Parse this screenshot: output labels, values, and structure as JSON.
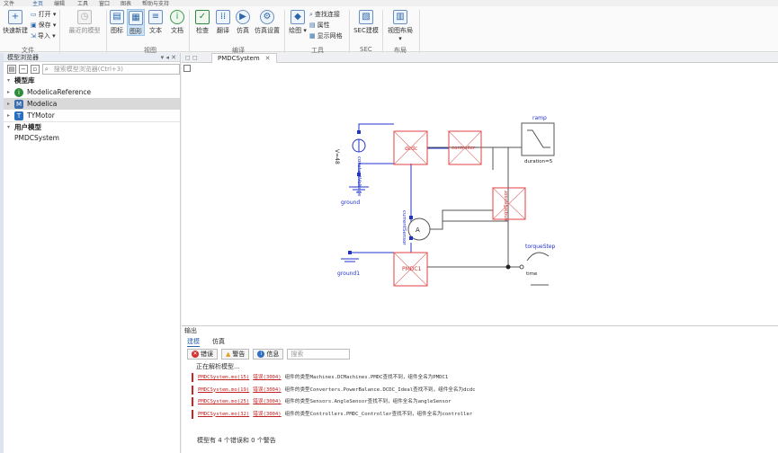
{
  "menubar": [
    "文件",
    "主页",
    "编辑",
    "工具",
    "窗口",
    "图表",
    "帮助与支持"
  ],
  "ribbon": {
    "file_group": {
      "new_label": "快速新建",
      "open_label": "打开",
      "save_label": "保存",
      "import_label": "导入",
      "group": "文件"
    },
    "recent_label": "最近的模型",
    "view_group": {
      "icon_label": "图标",
      "diagram_label": "图形",
      "text_label": "文本",
      "doc_label": "文档",
      "group": "视图"
    },
    "compile_group": {
      "check_label": "检查",
      "translate_label": "翻译",
      "simulate_label": "仿真",
      "sim_settings_label": "仿真设置",
      "group": "编译"
    },
    "tools_group": {
      "draw_label": "绘图",
      "find_conn_label": "查找连接",
      "attr_label": "属性",
      "grid_label": "显示网格",
      "group": "工具"
    },
    "sec_group": {
      "sec_model_label": "SEC建模",
      "group": "SEC"
    },
    "layout_group": {
      "view_layout_label": "视图布局",
      "group": "布局"
    }
  },
  "left_panel": {
    "title": "模型浏览器",
    "search_placeholder": "搜索模型浏览器(Ctrl+3)",
    "library_header": "模型库",
    "libraries": [
      {
        "label": "ModelicaReference",
        "color": "#2e8b3a",
        "glyph": "i"
      },
      {
        "label": "Modelica",
        "color": "#3c6fb0",
        "glyph": "M"
      },
      {
        "label": "TYMotor",
        "color": "#2b6fc0",
        "glyph": "T"
      }
    ],
    "user_header": "用户模型",
    "user_models": [
      "PMDCSystem"
    ]
  },
  "editor": {
    "tab_label": "PMDCSystem",
    "diagram": {
      "constantVoltage_label": "constantVoltage",
      "voltage_label": "V=48",
      "ground_label": "ground",
      "ground1_label": "ground1",
      "dcdc_label": "dcdc",
      "controller_label": "controller",
      "ramp_label": "ramp",
      "ramp_duration": "duration=5",
      "angleSensor_label": "angleSensor",
      "currentSensor_label": "currentSensor",
      "pmdc_label": "PMDC1",
      "torqueStep_label": "torqueStep",
      "time_label": "time"
    }
  },
  "output": {
    "title": "输出",
    "tabs": [
      "建模",
      "仿真"
    ],
    "filters": {
      "error_label": "错误",
      "warning_label": "警告",
      "info_label": "信息",
      "search_placeholder": "搜索"
    },
    "parsing_label": "正在解析模型...",
    "logs": [
      {
        "file": "PMDCSystem.mo(15)",
        "code": "错误(3004)",
        "msg": "组件的类型Machines.DCMachines.PMDC查找不到，组件全名为PMDC1"
      },
      {
        "file": "PMDCSystem.mo(19)",
        "code": "错误(3004)",
        "msg": "组件的类型Converters.PowerBalance.DCDC_Ideal查找不到，组件全名为dcdc"
      },
      {
        "file": "PMDCSystem.mo(25)",
        "code": "错误(3004)",
        "msg": "组件的类型Sensors.AngleSensor查找不到，组件全名为angleSensor"
      },
      {
        "file": "PMDCSystem.mo(32)",
        "code": "错误(3004)",
        "msg": "组件的类型Controllers.PMDC_Controller查找不到，组件全名为controller"
      }
    ],
    "summary": "模型有 4 个错误和 0 个警告"
  }
}
